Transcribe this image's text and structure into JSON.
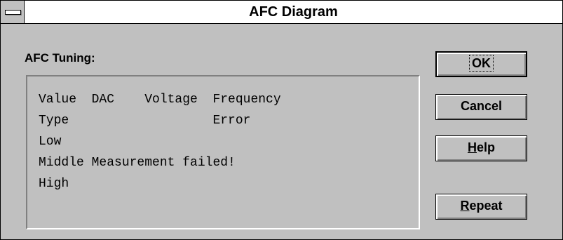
{
  "window": {
    "title": "AFC Diagram"
  },
  "group": {
    "label": "AFC Tuning:",
    "lines": [
      "Value  DAC    Voltage  Frequency",
      "Type                   Error",
      "Low",
      "Middle Measurement failed!",
      "High"
    ]
  },
  "buttons": {
    "ok": {
      "label": "OK",
      "mnemonic": ""
    },
    "cancel": {
      "label": "Cancel",
      "mnemonic": ""
    },
    "help": {
      "mnemonic": "H",
      "rest": "elp"
    },
    "repeat": {
      "mnemonic": "R",
      "rest": "epeat"
    }
  },
  "icons": {
    "system_menu": "system-menu-icon"
  },
  "colors": {
    "face": "#c0c0c0",
    "titlebar": "#ffffff",
    "shadow": "#808080",
    "highlight": "#ffffff",
    "text": "#000000"
  }
}
